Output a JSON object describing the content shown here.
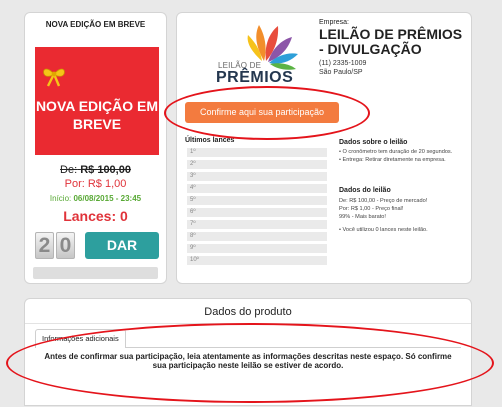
{
  "left_card": {
    "header": "NOVA EDIÇÃO EM BREVE",
    "image_text": "NOVA EDIÇÃO EM BREVE",
    "price_old_prefix": "De:",
    "price_old_value": "R$ 100,00",
    "price_new": "Por: R$ 1,00",
    "start_prefix": "Início:",
    "start_value": "06/08/2015 - 23:45",
    "lances": "Lances: 0",
    "countdown": [
      "2",
      "0"
    ],
    "button": "DAR LANCE"
  },
  "right_card": {
    "logo_top": "LEILÃO DE",
    "logo_main": "PRÊMIOS",
    "company_label": "Empresa:",
    "company_name": "LEILÃO DE PRÊMIOS - DIVULGAÇÃO",
    "phone": "(11) 2335-1009",
    "city": "São Paulo/SP",
    "confirm_button": "Confirme aqui sua participação",
    "last_bids_label": "Últimos lances",
    "bids": [
      "1º",
      "2º",
      "3º",
      "4º",
      "5º",
      "6º",
      "7º",
      "8º",
      "9º",
      "10º"
    ],
    "about_heading": "Dados sobre o leilão",
    "about_items": [
      "• O cronômetro tem duração de 20 segundos.",
      "• Entrega: Retirar diretamente na empresa."
    ],
    "data_heading": "Dados do leilão",
    "data_lines": [
      "De: R$ 100,00 - Preço de mercado!",
      "Por: R$ 1,00 - Preço final!",
      "99% - Mais barato!"
    ],
    "used_note": "• Você utilizou 0 lances neste leilão."
  },
  "bottom_card": {
    "title": "Dados do produto",
    "tab": "Informações adicionais",
    "notice": "Antes de confirmar sua participação, leia atentamente as informações descritas neste espaço. Só confirme sua participação neste leilão se estiver de acordo."
  },
  "colors": {
    "promo_red": "#ea2a31",
    "confirm_orange": "#f37b3f",
    "dar_lance_teal": "#2d9f9e",
    "annotation_red": "#e4141b",
    "start_green": "#58a935"
  }
}
